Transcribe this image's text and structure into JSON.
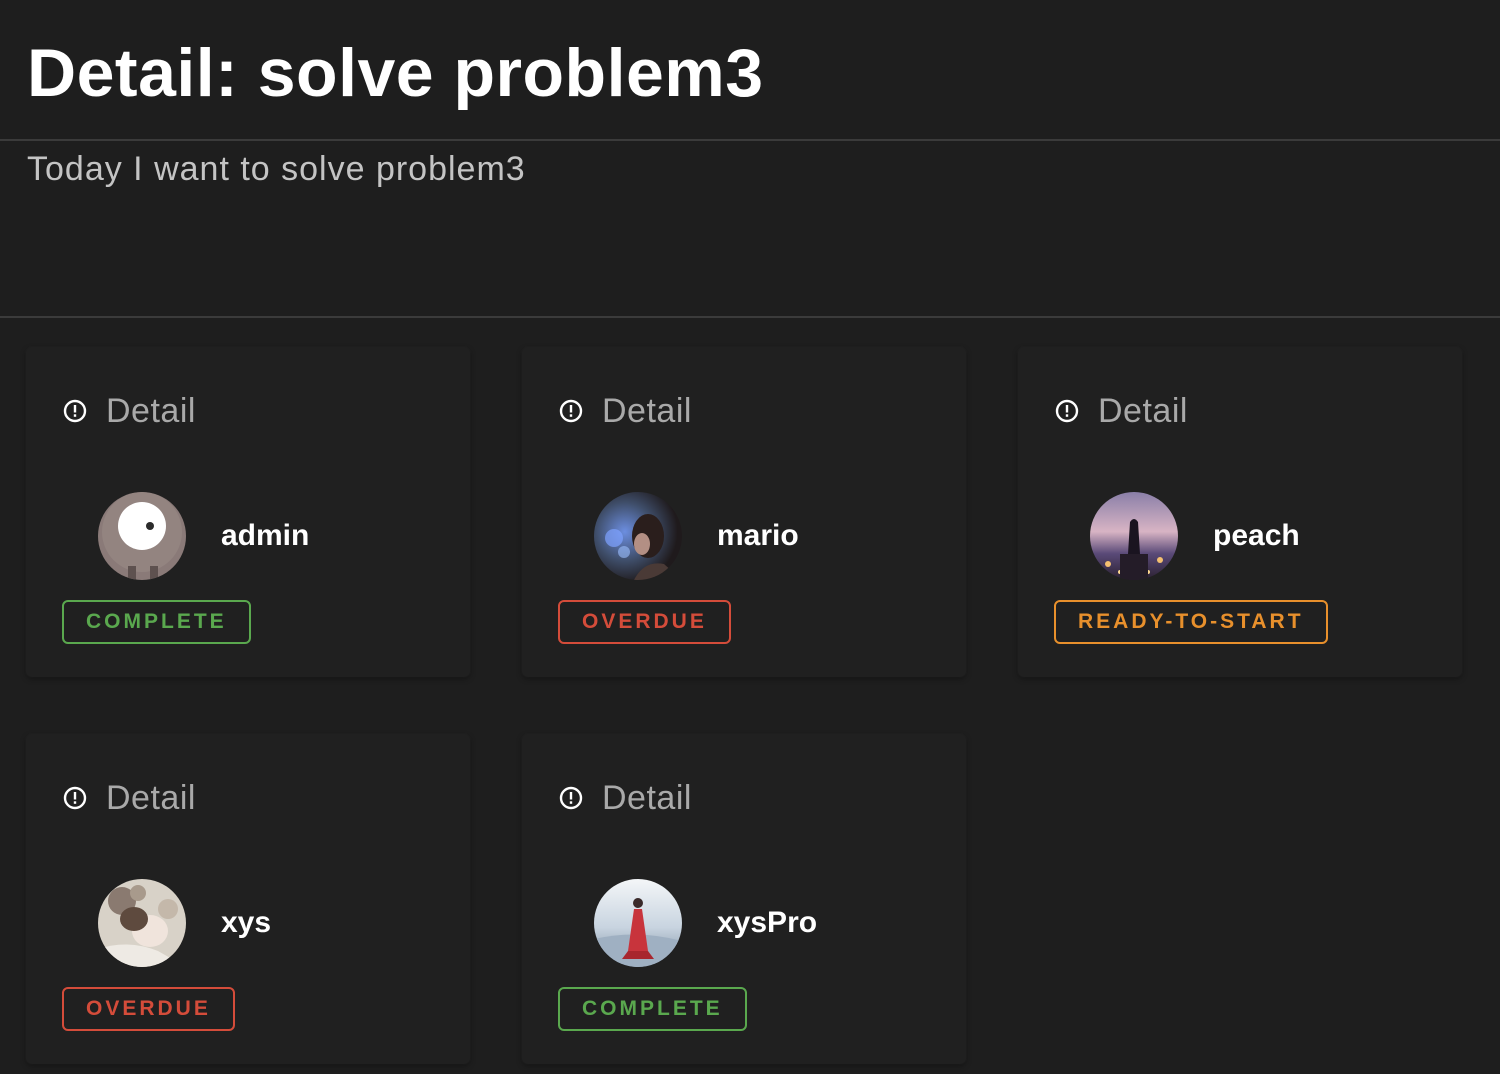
{
  "header": {
    "title": "Detail: solve problem3",
    "description": "Today I want to solve problem3"
  },
  "colors": {
    "complete": "#5aa84e",
    "overdue": "#d44c3a",
    "ready_to_start": "#e8902c"
  },
  "cards": [
    {
      "header_label": "Detail",
      "header_icon": "info-circle-icon",
      "username": "admin",
      "avatar": "avatar-admin",
      "status": "COMPLETE",
      "status_color": "#5aa84e"
    },
    {
      "header_label": "Detail",
      "header_icon": "info-circle-icon",
      "username": "mario",
      "avatar": "avatar-mario",
      "status": "OVERDUE",
      "status_color": "#d44c3a"
    },
    {
      "header_label": "Detail",
      "header_icon": "info-circle-icon",
      "username": "peach",
      "avatar": "avatar-peach",
      "status": "READY-TO-START",
      "status_color": "#e8902c"
    },
    {
      "header_label": "Detail",
      "header_icon": "info-circle-icon",
      "username": "xys",
      "avatar": "avatar-xys",
      "status": "OVERDUE",
      "status_color": "#d44c3a"
    },
    {
      "header_label": "Detail",
      "header_icon": "info-circle-icon",
      "username": "xysPro",
      "avatar": "avatar-xyspro",
      "status": "COMPLETE",
      "status_color": "#5aa84e"
    }
  ]
}
